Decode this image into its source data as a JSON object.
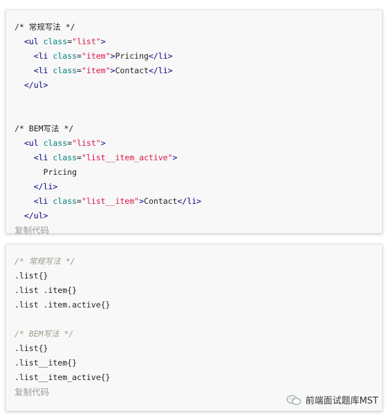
{
  "block1": {
    "lines": [
      [
        {
          "t": "plain",
          "v": "/* 常规写法 */"
        }
      ],
      [
        {
          "t": "plain",
          "v": "  "
        },
        {
          "t": "tag",
          "v": "<ul"
        },
        {
          "t": "plain",
          "v": " "
        },
        {
          "t": "attr",
          "v": "class"
        },
        {
          "t": "plain",
          "v": "="
        },
        {
          "t": "str",
          "v": "\"list\""
        },
        {
          "t": "tag",
          "v": ">"
        }
      ],
      [
        {
          "t": "plain",
          "v": "    "
        },
        {
          "t": "tag",
          "v": "<li"
        },
        {
          "t": "plain",
          "v": " "
        },
        {
          "t": "attr",
          "v": "class"
        },
        {
          "t": "plain",
          "v": "="
        },
        {
          "t": "str",
          "v": "\"item\""
        },
        {
          "t": "tag",
          "v": ">"
        },
        {
          "t": "plain",
          "v": "Pricing"
        },
        {
          "t": "tag",
          "v": "</li>"
        }
      ],
      [
        {
          "t": "plain",
          "v": "    "
        },
        {
          "t": "tag",
          "v": "<li"
        },
        {
          "t": "plain",
          "v": " "
        },
        {
          "t": "attr",
          "v": "class"
        },
        {
          "t": "plain",
          "v": "="
        },
        {
          "t": "str",
          "v": "\"item\""
        },
        {
          "t": "tag",
          "v": ">"
        },
        {
          "t": "plain",
          "v": "Contact"
        },
        {
          "t": "tag",
          "v": "</li>"
        }
      ],
      [
        {
          "t": "plain",
          "v": "  "
        },
        {
          "t": "tag",
          "v": "</ul>"
        }
      ],
      [],
      [],
      [
        {
          "t": "plain",
          "v": "/* BEM写法 */"
        }
      ],
      [
        {
          "t": "plain",
          "v": "  "
        },
        {
          "t": "tag",
          "v": "<ul"
        },
        {
          "t": "plain",
          "v": " "
        },
        {
          "t": "attr",
          "v": "class"
        },
        {
          "t": "plain",
          "v": "="
        },
        {
          "t": "str",
          "v": "\"list\""
        },
        {
          "t": "tag",
          "v": ">"
        }
      ],
      [
        {
          "t": "plain",
          "v": "    "
        },
        {
          "t": "tag",
          "v": "<li"
        },
        {
          "t": "plain",
          "v": " "
        },
        {
          "t": "attr",
          "v": "class"
        },
        {
          "t": "plain",
          "v": "="
        },
        {
          "t": "str",
          "v": "\"list__item_active\""
        },
        {
          "t": "tag",
          "v": ">"
        }
      ],
      [
        {
          "t": "plain",
          "v": "      Pricing"
        }
      ],
      [
        {
          "t": "plain",
          "v": "    "
        },
        {
          "t": "tag",
          "v": "</li>"
        }
      ],
      [
        {
          "t": "plain",
          "v": "    "
        },
        {
          "t": "tag",
          "v": "<li"
        },
        {
          "t": "plain",
          "v": " "
        },
        {
          "t": "attr",
          "v": "class"
        },
        {
          "t": "plain",
          "v": "="
        },
        {
          "t": "str",
          "v": "\"list__item\""
        },
        {
          "t": "tag",
          "v": ">"
        },
        {
          "t": "plain",
          "v": "Contact"
        },
        {
          "t": "tag",
          "v": "</li>"
        }
      ],
      [
        {
          "t": "plain",
          "v": "  "
        },
        {
          "t": "tag",
          "v": "</ul>"
        }
      ]
    ],
    "copy_label": "复制代码"
  },
  "block2": {
    "lines": [
      [
        {
          "t": "comment",
          "v": "/* 常规写法 */"
        }
      ],
      [
        {
          "t": "plain",
          "v": ".list{}"
        }
      ],
      [
        {
          "t": "plain",
          "v": ".list .item{}"
        }
      ],
      [
        {
          "t": "plain",
          "v": ".list .item.active{}"
        }
      ],
      [],
      [
        {
          "t": "comment",
          "v": "/* BEM写法 */"
        }
      ],
      [
        {
          "t": "plain",
          "v": ".list{}"
        }
      ],
      [
        {
          "t": "plain",
          "v": ".list__item{}"
        }
      ],
      [
        {
          "t": "plain",
          "v": ".list__item_active{}"
        }
      ]
    ],
    "copy_label": "复制代码"
  },
  "watermark": {
    "icon": "wechat-icon",
    "text": "前端面试题库MST"
  }
}
